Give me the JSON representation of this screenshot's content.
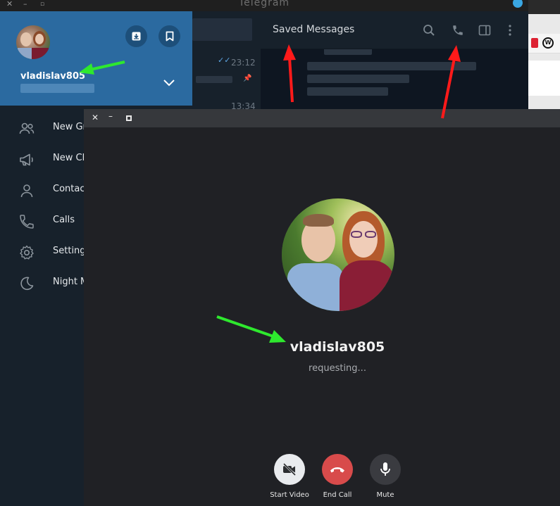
{
  "main_window": {
    "title": "Telegram"
  },
  "profile": {
    "username": "vladislav805",
    "phone_hidden": true
  },
  "chat": {
    "header_title": "Saved Messages",
    "times": [
      "23:12",
      "13:34"
    ]
  },
  "drawer_menu": [
    {
      "label": "New Gr",
      "icon": "group-icon"
    },
    {
      "label": "New Ch",
      "icon": "megaphone-icon"
    },
    {
      "label": "Contac",
      "icon": "contact-icon"
    },
    {
      "label": "Calls",
      "icon": "phone-icon"
    },
    {
      "label": "Setting",
      "icon": "gear-icon"
    },
    {
      "label": "Night M",
      "icon": "moon-icon"
    }
  ],
  "call": {
    "name": "vladislav805",
    "status": "requesting...",
    "buttons": {
      "video": "Start Video",
      "end": "End Call",
      "mute": "Mute"
    }
  },
  "colors": {
    "drawer_header": "#2b6aa0",
    "end_call": "#d84b4b",
    "green_arrow": "#2ee82e",
    "red_arrow": "#ff1a1a"
  }
}
